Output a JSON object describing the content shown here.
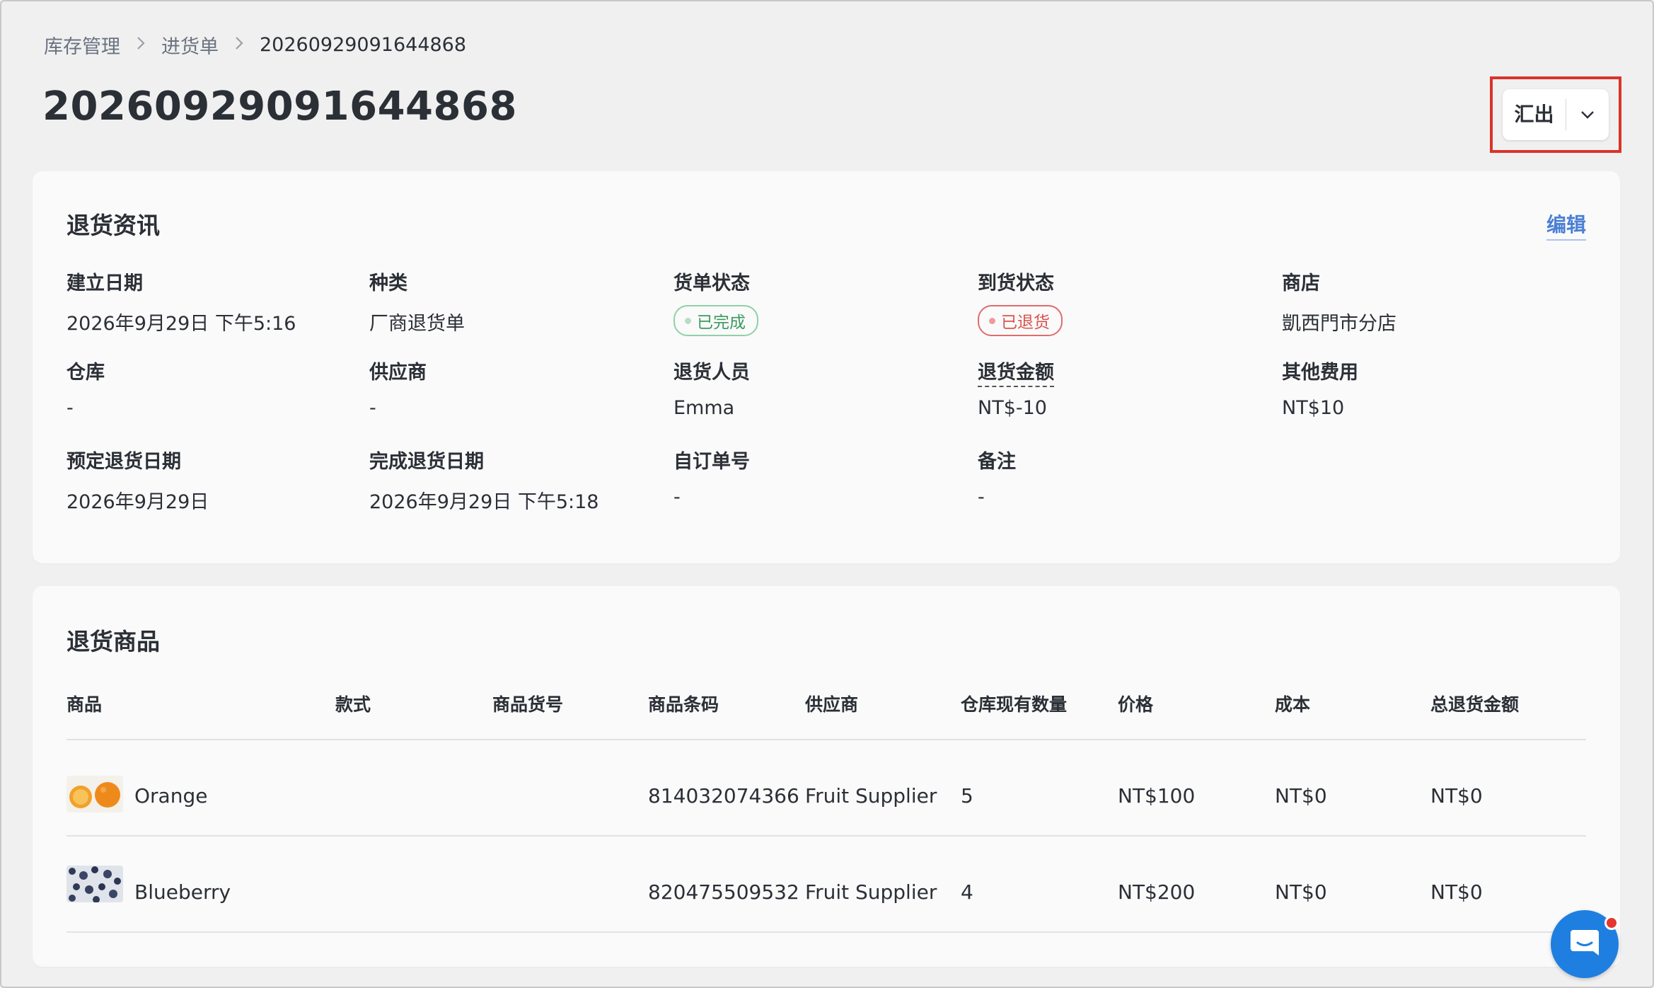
{
  "breadcrumb": {
    "items": [
      "库存管理",
      "进货单",
      "20260929091644868"
    ]
  },
  "page": {
    "title": "20260929091644868"
  },
  "toolbar": {
    "export_label": "汇出",
    "highlight_color": "#d9342b"
  },
  "info": {
    "title": "退货资讯",
    "edit_label": "编辑",
    "fields": {
      "created_date": {
        "label": "建立日期",
        "value": "2026年9月29日 下午5:16"
      },
      "type": {
        "label": "种类",
        "value": "厂商退货单"
      },
      "order_status": {
        "label": "货单状态",
        "value": "已完成"
      },
      "arrival_status": {
        "label": "到货状态",
        "value": "已退货"
      },
      "store": {
        "label": "商店",
        "value": "凱西門市分店"
      },
      "warehouse": {
        "label": "仓库",
        "value": "-"
      },
      "supplier": {
        "label": "供应商",
        "value": "-"
      },
      "staff": {
        "label": "退货人员",
        "value": "Emma"
      },
      "return_amount": {
        "label": "退货金额",
        "value": "NT$-10"
      },
      "other_fees": {
        "label": "其他费用",
        "value": "NT$10"
      },
      "scheduled_date": {
        "label": "预定退货日期",
        "value": "2026年9月29日"
      },
      "completed_date": {
        "label": "完成退货日期",
        "value": "2026年9月29日 下午5:18"
      },
      "custom_order_no": {
        "label": "自订单号",
        "value": "-"
      },
      "notes": {
        "label": "备注",
        "value": "-"
      }
    },
    "status_colors": {
      "completed": "#3a9b5e",
      "returned": "#d9534f"
    }
  },
  "items": {
    "title": "退货商品",
    "columns": [
      "商品",
      "款式",
      "商品货号",
      "商品条码",
      "供应商",
      "仓库现有数量",
      "价格",
      "成本",
      "总退货金额"
    ],
    "rows": [
      {
        "product": "Orange",
        "variant": "",
        "sku": "",
        "barcode": "814032074366",
        "supplier": "Fruit Supplier",
        "stock": "5",
        "price": "NT$100",
        "cost": "NT$0",
        "total": "NT$0"
      },
      {
        "product": "Blueberry",
        "variant": "",
        "sku": "",
        "barcode": "820475509532",
        "supplier": "Fruit Supplier",
        "stock": "4",
        "price": "NT$200",
        "cost": "NT$0",
        "total": "NT$0"
      }
    ]
  },
  "chat": {
    "icon": "chat-bubble-icon",
    "color": "#1f7fe0"
  }
}
